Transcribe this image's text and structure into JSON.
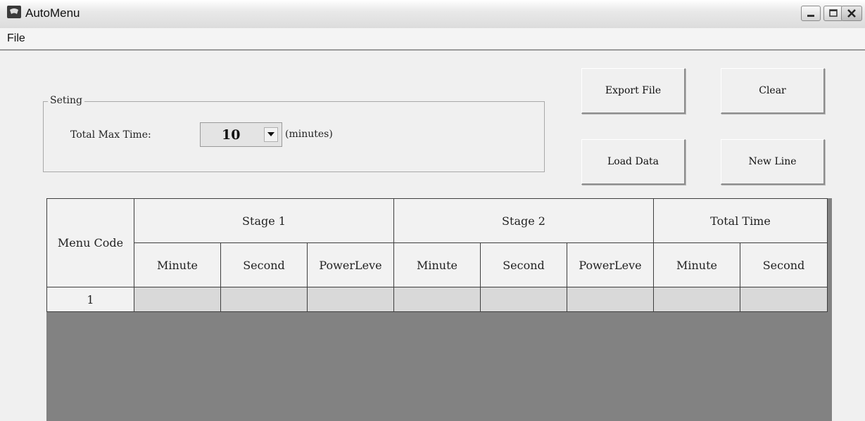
{
  "window": {
    "title": "AutoMenu"
  },
  "menu": {
    "file": "File"
  },
  "setting": {
    "legend": "Seting",
    "max_time_label": "Total Max Time:",
    "max_time_value": "10",
    "unit_label": "(minutes)"
  },
  "buttons": {
    "export": "Export File",
    "clear": "Clear",
    "load": "Load Data",
    "new_line": "New Line"
  },
  "table": {
    "menu_code_header": "Menu Code",
    "stage1": "Stage 1",
    "stage2": "Stage 2",
    "total_time": "Total Time",
    "sub_headers": [
      "Minute",
      "Second",
      "PowerLeve",
      "Minute",
      "Second",
      "PowerLeve",
      "Minute",
      "Second"
    ],
    "rows": [
      {
        "code": "1",
        "cells": [
          "",
          "",
          "",
          "",
          "",
          "",
          "",
          ""
        ]
      }
    ]
  }
}
